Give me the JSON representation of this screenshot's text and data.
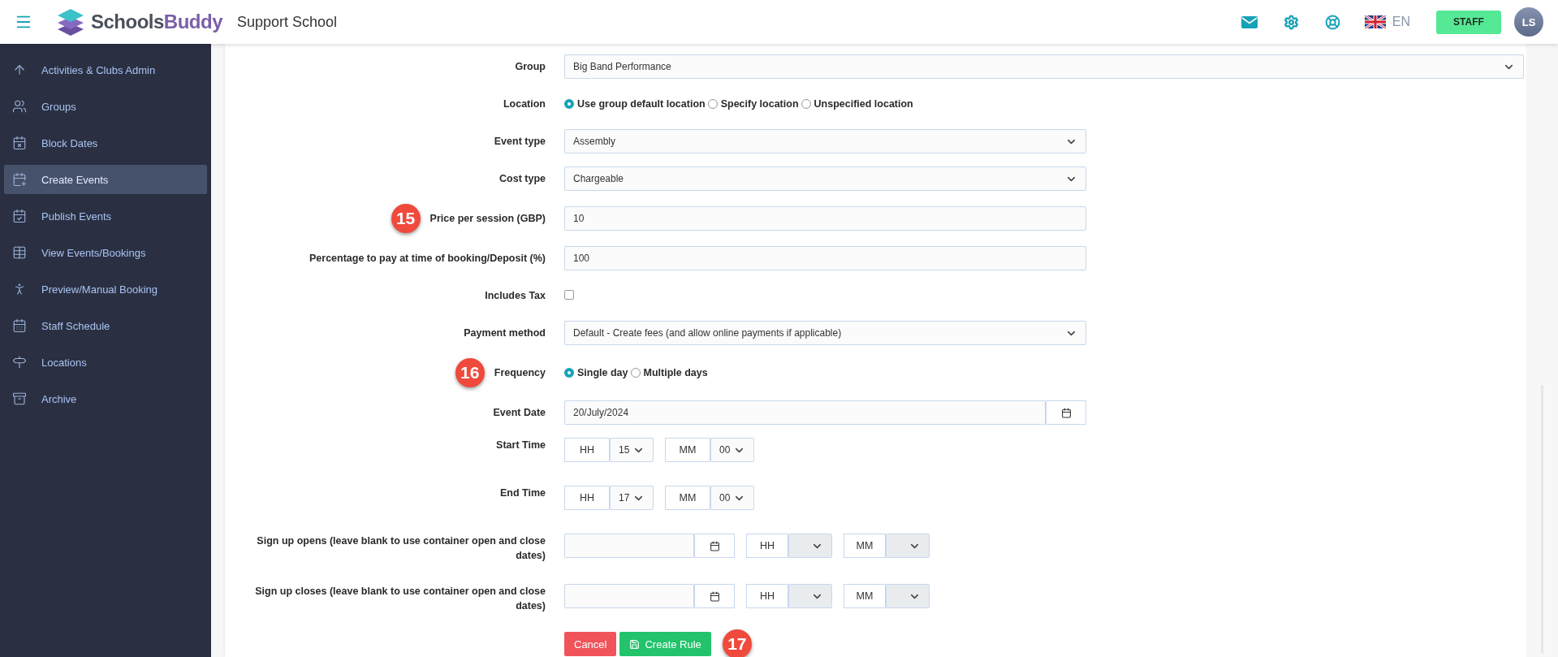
{
  "header": {
    "logo": {
      "first": "Schools",
      "second": "Buddy"
    },
    "school": "Support School",
    "language": "EN",
    "role_button": "STAFF",
    "avatar": "LS"
  },
  "sidebar": {
    "items": [
      {
        "label": "Activities & Clubs Admin",
        "selected": false
      },
      {
        "label": "Groups",
        "selected": false
      },
      {
        "label": "Block Dates",
        "selected": false
      },
      {
        "label": "Create Events",
        "selected": true
      },
      {
        "label": "Publish Events",
        "selected": false
      },
      {
        "label": "View Events/Bookings",
        "selected": false
      },
      {
        "label": "Preview/Manual Booking",
        "selected": false
      },
      {
        "label": "Staff Schedule",
        "selected": false
      },
      {
        "label": "Locations",
        "selected": false
      },
      {
        "label": "Archive",
        "selected": false
      }
    ]
  },
  "form": {
    "rows": [
      {
        "kind": "wide_select",
        "label": "Group",
        "value": "Big Band Performance"
      },
      {
        "kind": "radio",
        "label": "Location",
        "options": [
          {
            "label": "Use group default location",
            "selected": true
          },
          {
            "label": "Specify location",
            "selected": false
          },
          {
            "label": "Unspecified location",
            "selected": false
          }
        ]
      },
      {
        "kind": "select",
        "label": "Event type",
        "value": "Assembly"
      },
      {
        "kind": "select",
        "label": "Cost type",
        "value": "Chargeable"
      },
      {
        "kind": "text",
        "label": "Price per session (GBP)",
        "value": "10",
        "badge": "15"
      },
      {
        "kind": "text",
        "label": "Percentage to pay at time of booking/Deposit (%)",
        "value": "100"
      },
      {
        "kind": "checkbox",
        "label": "Includes Tax",
        "checked": false
      },
      {
        "kind": "select",
        "label": "Payment method",
        "value": "Default - Create fees (and allow online payments if applicable)"
      },
      {
        "kind": "radio",
        "label": "Frequency",
        "badge": "16",
        "options": [
          {
            "label": "Single day",
            "selected": true
          },
          {
            "label": "Multiple days",
            "selected": false
          }
        ]
      },
      {
        "kind": "date",
        "label": "Event Date",
        "value": "20/July/2024"
      },
      {
        "kind": "time",
        "label": "Start Time",
        "hour_label": "HH",
        "hour": "15",
        "minute_label": "MM",
        "minute": "00"
      },
      {
        "kind": "time",
        "label": "End Time",
        "hour_label": "HH",
        "hour": "17",
        "minute_label": "MM",
        "minute": "00"
      },
      {
        "kind": "signup",
        "label": "Sign up opens (leave blank to use container open and close dates)",
        "hour_label": "HH",
        "minute_label": "MM"
      },
      {
        "kind": "signup",
        "label": "Sign up closes (leave blank to use container open and close dates)",
        "hour_label": "HH",
        "minute_label": "MM"
      }
    ],
    "actions": {
      "cancel": "Cancel",
      "submit": "Create Rule",
      "badge": "17"
    }
  }
}
